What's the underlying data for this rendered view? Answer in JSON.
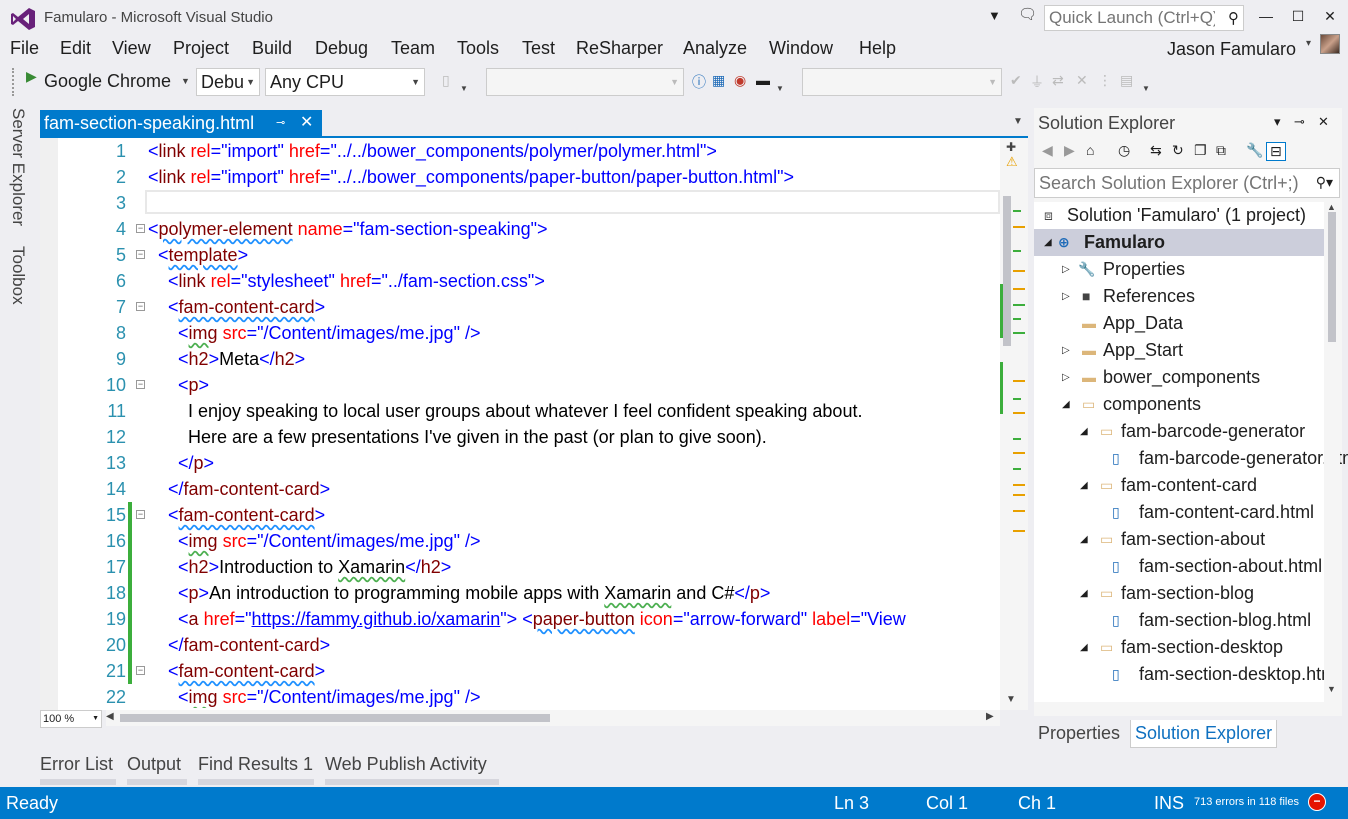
{
  "window": {
    "title": "Famularo - Microsoft Visual Studio",
    "quick_launch_placeholder": "Quick Launch (Ctrl+Q)",
    "user_name": "Jason Famularo"
  },
  "menu": [
    "File",
    "Edit",
    "View",
    "Project",
    "Build",
    "Debug",
    "Team",
    "Tools",
    "Test",
    "ReSharper",
    "Analyze",
    "Window",
    "Help"
  ],
  "toolbar": {
    "run_target": "Google Chrome",
    "configuration": "Debu",
    "platform": "Any CPU"
  },
  "left_rail": [
    "Server Explorer",
    "Toolbox"
  ],
  "document_tab": {
    "label": "fam-section-speaking.html"
  },
  "editor": {
    "zoom": "100 %",
    "lines": [
      {
        "n": "1"
      },
      {
        "n": "2"
      },
      {
        "n": "3"
      },
      {
        "n": "4"
      },
      {
        "n": "5"
      },
      {
        "n": "6"
      },
      {
        "n": "7"
      },
      {
        "n": "8"
      },
      {
        "n": "9"
      },
      {
        "n": "10"
      },
      {
        "n": "11"
      },
      {
        "n": "12"
      },
      {
        "n": "13"
      },
      {
        "n": "14"
      },
      {
        "n": "15"
      },
      {
        "n": "16"
      },
      {
        "n": "17"
      },
      {
        "n": "18"
      },
      {
        "n": "19"
      },
      {
        "n": "20"
      },
      {
        "n": "21"
      },
      {
        "n": "22"
      }
    ],
    "text": {
      "l1_href": "\"../../bower_components/polymer/polymer.html\"",
      "l2_href": "\"../../bower_components/paper-button/paper-button.html\"",
      "l4_name": "\"fam-section-speaking\"",
      "l6_href": "\"../fam-section.css\"",
      "img_src": "\"/Content/images/me.jpg\"",
      "l9_text": "Meta",
      "l11_text": "I enjoy speaking to local user groups about whatever I feel confident speaking about.",
      "l12_text": "Here are a few presentations I've given in the past (or plan to give soon).",
      "l17_text_a": "Introduction to ",
      "l17_text_b": "Xamarin",
      "l18_text_a": "An introduction to programming mobile apps with ",
      "l18_text_b": "Xamarin",
      "l18_text_c": " and C#",
      "l19_href": "https://fammy.github.io/xamarin",
      "l19_icon": "\"arrow-forward\"",
      "l19_label": "\"View"
    }
  },
  "solution_explorer": {
    "title": "Solution Explorer",
    "search_placeholder": "Search Solution Explorer (Ctrl+;)",
    "tree": [
      {
        "label": "Solution 'Famularo' (1 project)",
        "bold": false
      },
      {
        "label": "Famularo",
        "bold": true
      },
      {
        "label": "Properties"
      },
      {
        "label": "References"
      },
      {
        "label": "App_Data"
      },
      {
        "label": "App_Start"
      },
      {
        "label": "bower_components"
      },
      {
        "label": "components"
      },
      {
        "label": "fam-barcode-generator"
      },
      {
        "label": "fam-barcode-generator.html"
      },
      {
        "label": "fam-content-card"
      },
      {
        "label": "fam-content-card.html"
      },
      {
        "label": "fam-section-about"
      },
      {
        "label": "fam-section-about.html"
      },
      {
        "label": "fam-section-blog"
      },
      {
        "label": "fam-section-blog.html"
      },
      {
        "label": "fam-section-desktop"
      },
      {
        "label": "fam-section-desktop.html"
      }
    ],
    "tabs": [
      "Properties",
      "Solution Explorer"
    ]
  },
  "bottom_tabs": [
    "Error List",
    "Output",
    "Find Results 1",
    "Web Publish Activity"
  ],
  "status": {
    "state": "Ready",
    "ln": "Ln 3",
    "col": "Col 1",
    "ch": "Ch 1",
    "mode": "INS",
    "errors": "713 errors in 118 files"
  },
  "colors": {
    "accent": "#007acc",
    "chrome": "#eeeef2",
    "change_bar": "#3cae3c",
    "error": "#e51400"
  }
}
